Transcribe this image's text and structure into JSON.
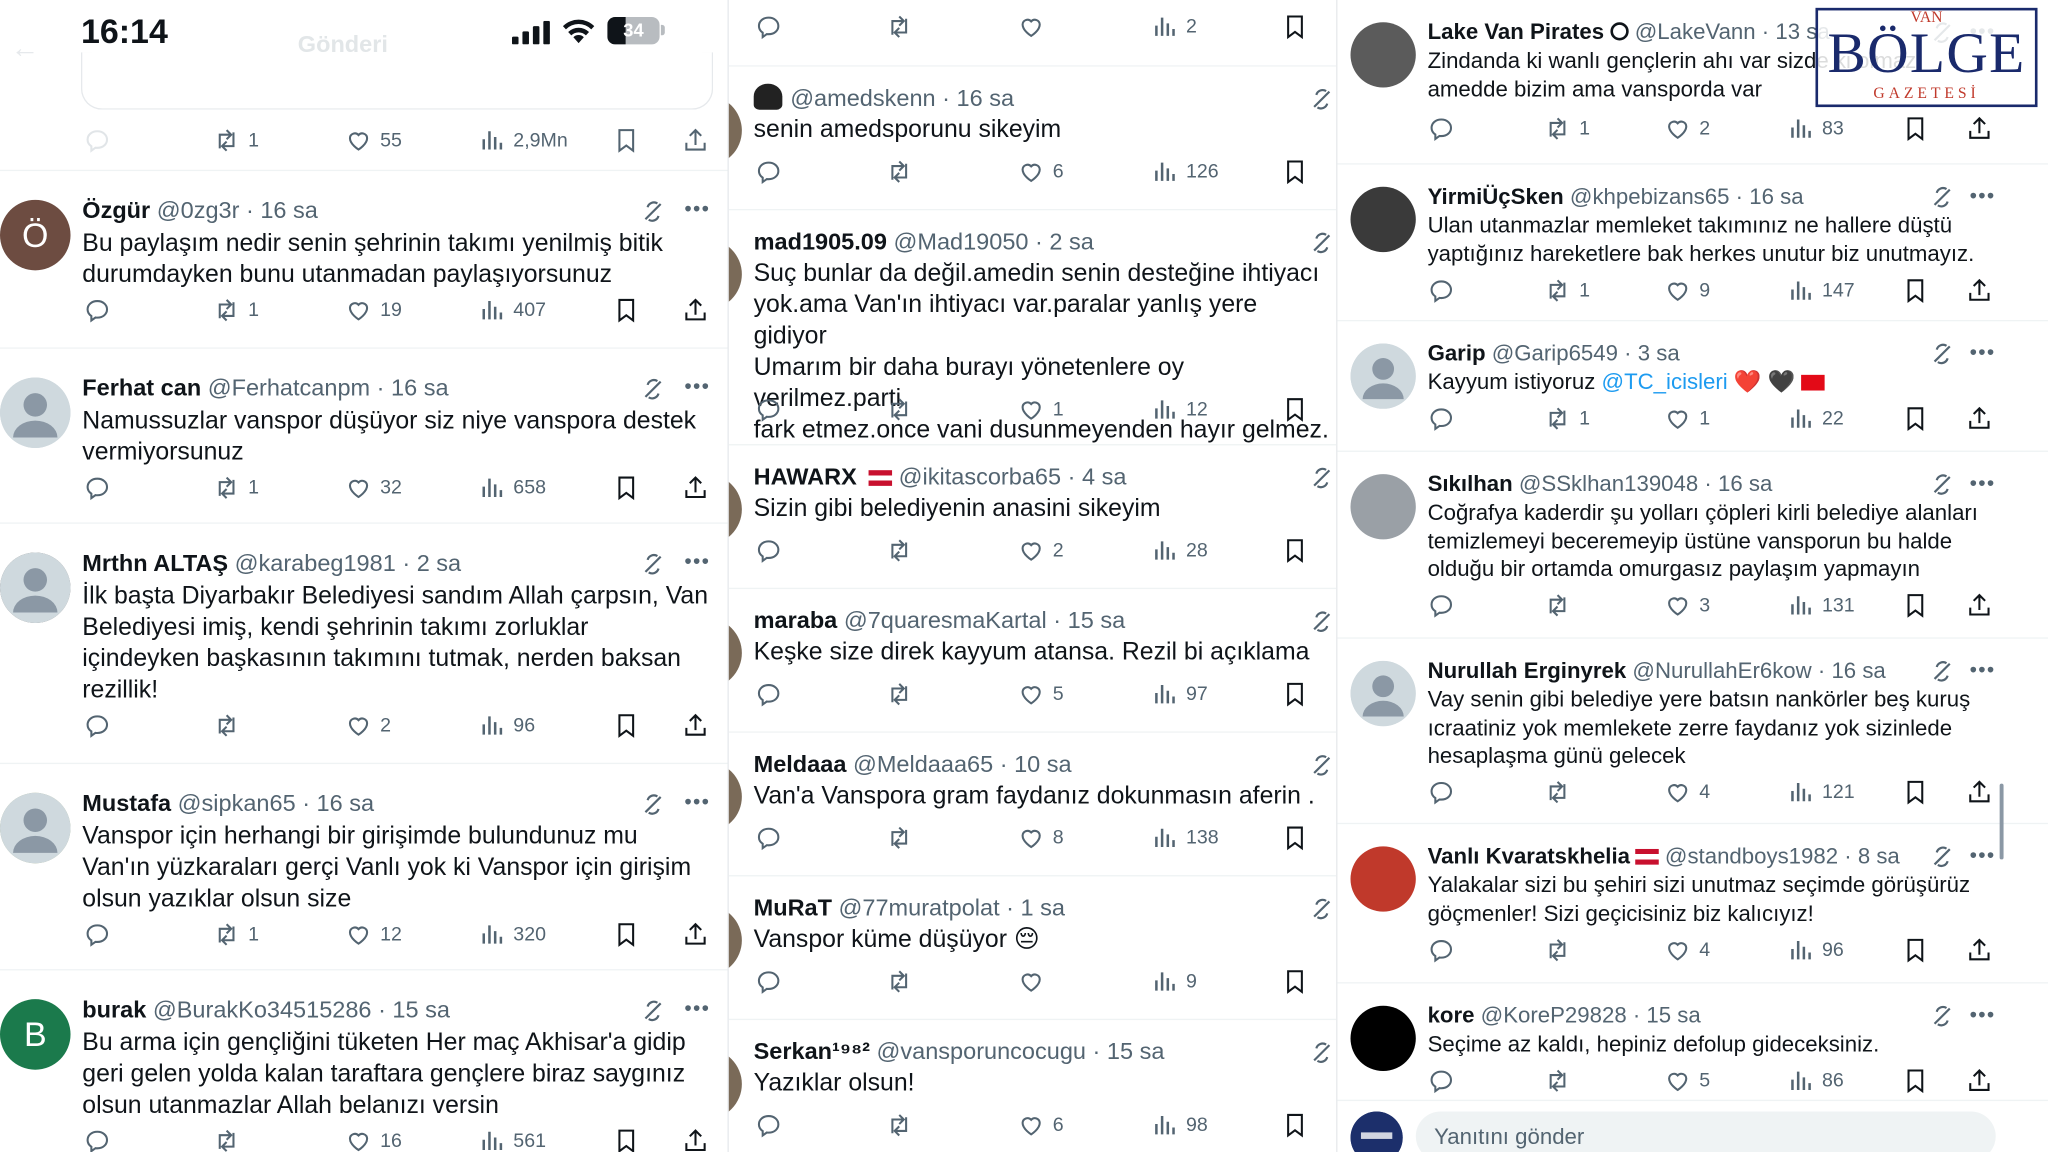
{
  "status_bar": {
    "time": "16:14",
    "battery": "34"
  },
  "top_header": {
    "title": "Gönderi"
  },
  "col1": {
    "partial_top": {
      "retweets": "1",
      "likes": "55",
      "views": "2,9Mn"
    },
    "replies": [
      {
        "name": "Özgür",
        "handle": "@0zg3r",
        "time": "· 16 sa",
        "text": "Bu paylaşım nedir senin şehrinin takımı yenilmiş bitik\ndurumdayken bunu utanmadan paylaşıyorsunuz",
        "replies": "",
        "retweets": "1",
        "likes": "19",
        "views": "407",
        "avatar_letter": "Ö",
        "avatar_color": "#6d4c41"
      },
      {
        "name": "Ferhat can",
        "handle": "@Ferhatcanpm",
        "time": "· 16 sa",
        "text": "Namussuzlar vanspor düşüyor siz niye vanspora destek\nvermiyorsunuz",
        "replies": "",
        "retweets": "1",
        "likes": "32",
        "views": "658",
        "avatar_letter": "",
        "avatar_color": "#cfd9de"
      },
      {
        "name": "Mrthn ALTAŞ",
        "handle": "@karabeg1981",
        "time": "· 2 sa",
        "text": "İlk başta Diyarbakır Belediyesi sandım Allah çarpsın, Van\nBelediyesi imiş, kendi şehrinin takımı zorluklar\niçindeyken başkasının takımını tutmak, nerden baksan\nrezillik!",
        "replies": "",
        "retweets": "",
        "likes": "2",
        "views": "96",
        "avatar_letter": "",
        "avatar_color": "#8a8a8a"
      },
      {
        "name": "Mustafa",
        "handle": "@sipkan65",
        "time": "· 16 sa",
        "text": "Vanspor için herhangi bir girişimde bulundunuz mu\nVan'ın yüzkaraları gerçi Vanlı yok ki Vanspor için girişim\nolsun yazıklar olsun size",
        "replies": "",
        "retweets": "1",
        "likes": "12",
        "views": "320",
        "avatar_letter": "",
        "avatar_color": "#a7b59c"
      },
      {
        "name": "burak",
        "handle": "@BurakKo34515286",
        "time": "· 15 sa",
        "text": "Bu arma için gençliğini tüketen Her maç Akhisar'a gidip\ngeri gelen yolda kalan taraftara gençlere biraz saygınız\nolsun utanmazlar Allah belanızı versin",
        "replies": "",
        "retweets": "",
        "likes": "16",
        "views": "561",
        "avatar_letter": "B",
        "avatar_color": "#1b7a4c"
      }
    ]
  },
  "col2": {
    "partial_top": {
      "likes": "",
      "views": "2"
    },
    "replies": [
      {
        "name": "",
        "handle": "@amedskenn",
        "time": "· 16 sa",
        "text": "senin amedsporunu sikeyim",
        "likes": "6",
        "views": "126",
        "emoji_name": "ninja"
      },
      {
        "name": "mad1905.09",
        "handle": "@Mad19050",
        "time": "· 2 sa",
        "text": "Suç bunlar da değil.amedin senin desteğine ihtiyacı\nyok.ama Van'ın ihtiyacı var.paralar yanlış yere gidiyor\nUmarım bir daha burayı yönetenlere oy verilmez.parti\nfark etmez.once vani dusunmeyenden hayır gelmez.",
        "likes": "1",
        "views": "12"
      },
      {
        "name": "HAWARX",
        "handle": "@ikitascorba65",
        "time": "· 4 sa",
        "text": "Sizin gibi belediyenin anasini sikeyim",
        "likes": "2",
        "views": "28"
      },
      {
        "name": "maraba",
        "handle": "@7quaresmaKartal",
        "time": "· 15 sa",
        "text": "Keşke size direk kayyum atansa. Rezil bi açıklama",
        "likes": "5",
        "views": "97"
      },
      {
        "name": "Meldaaa",
        "handle": "@Meldaaa65",
        "time": "· 10 sa",
        "text": "Van'a Vanspora gram faydanız dokunmasın aferin .",
        "likes": "8",
        "views": "138"
      },
      {
        "name": "MuRaT",
        "handle": "@77muratpolat",
        "time": "· 1 sa",
        "text": "Vanspor küme düşüyor 😔",
        "likes": "",
        "views": "9"
      },
      {
        "name": "Serkan¹⁹⁸²",
        "handle": "@vansporuncocugu",
        "time": "· 15 sa",
        "text": "Yazıklar olsun!",
        "likes": "6",
        "views": "98"
      }
    ]
  },
  "col3": {
    "logo": {
      "line1": "VAN",
      "line2": "BÖLGE",
      "line3": "GAZETESİ"
    },
    "replies": [
      {
        "name": "Lake Van Pirates",
        "handle": "@LakeVann",
        "time": "· 13 sa",
        "text": "Zindanda ki wanlı gençlerin ahı var sizde ki olmaz\namedde bizim ama vansporda var",
        "retweets": "1",
        "likes": "2",
        "views": "83",
        "avatar_color": "#5b5b5b"
      },
      {
        "name": "YirmiÜçSken",
        "handle": "@khpebizans65",
        "time": "· 16 sa",
        "text": "Ulan utanmazlar memleket takımınız ne hallere düştü\nyaptığınız hareketlere bak herkes unutur biz unutmayız.",
        "retweets": "1",
        "likes": "9",
        "views": "147",
        "avatar_color": "#3a3a3a"
      },
      {
        "name": "Garip",
        "handle": "@Garip6549",
        "time": "· 3 sa",
        "text_prefix": "Kayyum istiyoruz ",
        "mention": "@TC_icisleri",
        "text_suffix": " ❤️ 🖤",
        "retweets": "1",
        "likes": "1",
        "views": "22",
        "avatar_color": "#cfd9de"
      },
      {
        "name": "Sıkılhan",
        "handle": "@SSklhan139048",
        "time": "· 16 sa",
        "text": "Coğrafya kaderdir şu yolları çöpleri kirli belediye alanları\ntemizlemeyi beceremeyip üstüne vansporun bu halde\nolduğu bir ortamda omurgasız paylaşım yapmayın",
        "retweets": "",
        "likes": "3",
        "views": "131",
        "avatar_color": "#9aa0a6"
      },
      {
        "name": "Nurullah Erginyrek",
        "handle": "@NurullahEr6kow",
        "time": "· 16 sa",
        "text": "Vay senin gibi belediye yere batsın nankörler beş kuruş\nıcraatiniz yok memlekete zerre faydanız yok sizinlede\nhesaplaşma günü gelecek",
        "retweets": "",
        "likes": "4",
        "views": "121",
        "avatar_color": "#cfd9de"
      },
      {
        "name": "Vanlı Kvaratskhelia",
        "handle": "@standboys1982",
        "time": "· 8 sa",
        "text": "Yalakalar sizi bu şehiri sizi unutmaz seçimde görüşürüz\ngöçmenler! Sizi geçicisiniz biz kalıcıyız!",
        "retweets": "",
        "likes": "4",
        "views": "96",
        "avatar_color": "#c0392b"
      },
      {
        "name": "kore",
        "handle": "@KoreP29828",
        "time": "· 15 sa",
        "text": "Seçime az kaldı, hepiniz defolup gideceksiniz.",
        "retweets": "",
        "likes": "5",
        "views": "86",
        "avatar_color": "#000000"
      }
    ],
    "compose": {
      "placeholder": "Yanıtını gönder"
    }
  }
}
